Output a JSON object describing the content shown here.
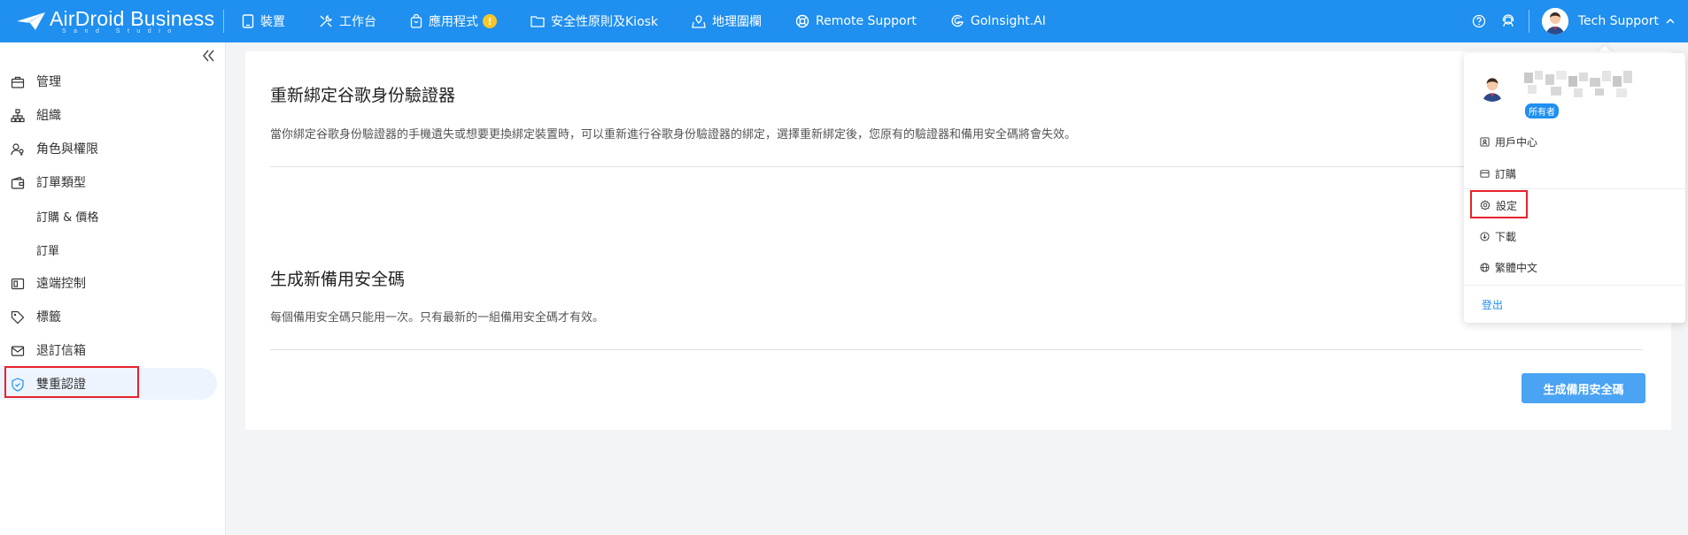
{
  "brand": {
    "logo_main": "AirDroid Business",
    "logo_sub": "Sand Studio"
  },
  "topnav": {
    "items": [
      {
        "label": "裝置",
        "icon": "tablet-icon"
      },
      {
        "label": "工作台",
        "icon": "tools-icon"
      },
      {
        "label": "應用程式",
        "icon": "app-bag-icon",
        "badge": "!"
      },
      {
        "label": "安全性原則及Kiosk",
        "icon": "folder-icon"
      },
      {
        "label": "地理圍欄",
        "icon": "map-pin-icon"
      },
      {
        "label": "Remote Support",
        "icon": "lifebuoy-icon"
      },
      {
        "label": "GoInsight.AI",
        "icon": "goinsight-icon"
      }
    ],
    "user_name": "Tech Support"
  },
  "sidebar": {
    "items": [
      {
        "label": "管理",
        "icon": "briefcase-icon"
      },
      {
        "label": "組織",
        "icon": "org-chart-icon"
      },
      {
        "label": "角色與權限",
        "icon": "user-key-icon"
      },
      {
        "label": "訂單類型",
        "icon": "wallet-icon"
      },
      {
        "label": "訂購 & 價格"
      },
      {
        "label": "訂單"
      },
      {
        "label": "遠端控制",
        "icon": "remote-screen-icon"
      },
      {
        "label": "標籤",
        "icon": "tag-icon"
      },
      {
        "label": "退訂信箱",
        "icon": "mail-icon"
      },
      {
        "label": "雙重認證",
        "icon": "shield-check-icon",
        "active": true
      }
    ]
  },
  "main": {
    "rebind": {
      "title": "重新綁定谷歌身份驗證器",
      "description": "當你綁定谷歌身份驗證器的手機遺失或想要更換綁定裝置時，可以重新進行谷歌身份驗證器的綁定，選擇重新綁定後，您原有的驗證器和備用安全碼將會失效。"
    },
    "backup": {
      "title": "生成新備用安全碼",
      "description": "每個備用安全碼只能用一次。只有最新的一組備用安全碼才有效。",
      "button": "生成備用安全碼"
    }
  },
  "dropdown": {
    "role_badge": "所有者",
    "items": [
      {
        "label": "用戶中心",
        "icon": "user-card-icon"
      },
      {
        "label": "訂購",
        "icon": "credit-card-icon"
      },
      {
        "label": "設定",
        "icon": "gear-icon"
      },
      {
        "label": "下載",
        "icon": "download-icon"
      },
      {
        "label": "繁體中文",
        "icon": "globe-icon"
      }
    ],
    "logout": "登出"
  },
  "colors": {
    "topbar": "#1f8ff0",
    "primary_button": "#4ba3f4",
    "highlight": "#e5232b",
    "active_bg": "#eef4fe"
  }
}
